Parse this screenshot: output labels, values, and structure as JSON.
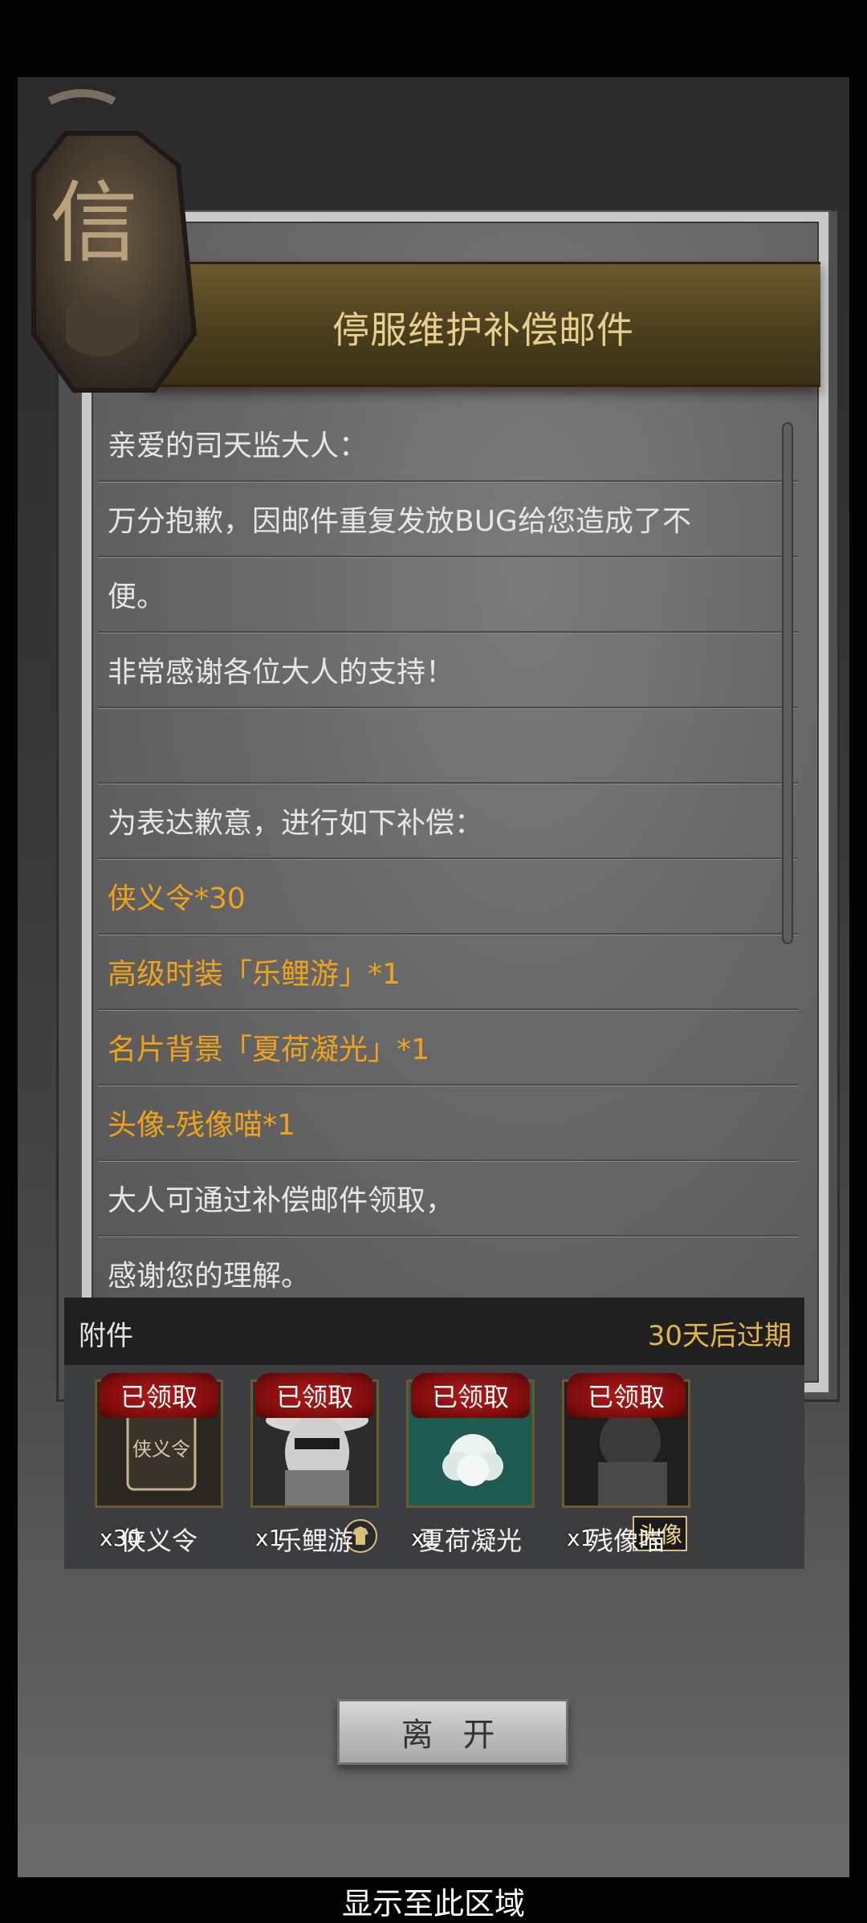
{
  "mail": {
    "title": "停服维护补偿邮件",
    "seal_char": "信",
    "lines": [
      {
        "text": "亲爱的司天监大人：",
        "style": "normal"
      },
      {
        "text": "万分抱歉，因邮件重复发放BUG给您造成了不",
        "style": "normal"
      },
      {
        "text": "便。",
        "style": "normal"
      },
      {
        "text": "非常感谢各位大人的支持！",
        "style": "normal"
      },
      {
        "text": "",
        "style": "normal"
      },
      {
        "text": "为表达歉意，进行如下补偿：",
        "style": "normal"
      },
      {
        "text": "侠义令*30",
        "style": "orange"
      },
      {
        "text": "高级时装「乐鲤游」*1",
        "style": "orange"
      },
      {
        "text": "名片背景「夏荷凝光」*1",
        "style": "orange"
      },
      {
        "text": "头像-残像喵*1",
        "style": "orange"
      },
      {
        "text": "大人可通过补偿邮件领取，",
        "style": "normal"
      },
      {
        "text": "感谢您的理解。",
        "style": "normal"
      }
    ]
  },
  "attachments": {
    "label": "附件",
    "expiry": "30天后过期",
    "items": [
      {
        "status": "已领取",
        "quantity": "x30",
        "name": "侠义令",
        "icon_text": "侠义令"
      },
      {
        "status": "已领取",
        "quantity": "x1",
        "name": "乐鲤游",
        "icon": "shirt-icon"
      },
      {
        "status": "已领取",
        "quantity": "x1",
        "name": "夏荷凝光"
      },
      {
        "status": "已领取",
        "quantity": "x1",
        "name": "残像喵",
        "tag": "头像"
      }
    ]
  },
  "actions": {
    "leave": "离 开"
  },
  "footer": {
    "caption": "显示至此区域"
  }
}
